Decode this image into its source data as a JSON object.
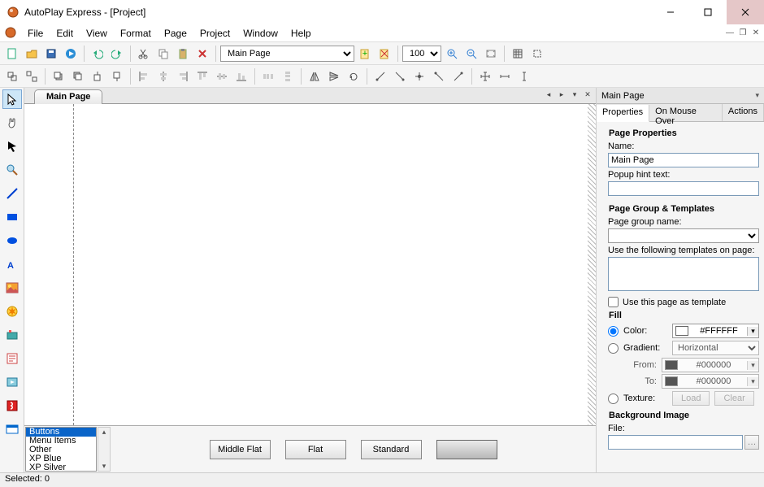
{
  "window": {
    "title": "AutoPlay Express - [Project]"
  },
  "menu": {
    "items": [
      "File",
      "Edit",
      "View",
      "Format",
      "Page",
      "Project",
      "Window",
      "Help"
    ]
  },
  "toolbar1": {
    "page_combo": "Main Page",
    "zoom_combo": "100%"
  },
  "page_tab": {
    "label": "Main Page"
  },
  "tool_palette": {
    "categories": [
      "Buttons",
      "Menu Items",
      "Other",
      "XP Blue",
      "XP Silver"
    ],
    "previews": [
      "Middle Flat",
      "Flat",
      "Standard",
      ""
    ]
  },
  "props": {
    "header": "Main Page",
    "tabs": [
      "Properties",
      "On Mouse Over",
      "Actions"
    ],
    "page_properties": {
      "title": "Page Properties",
      "name_label": "Name:",
      "name_value": "Main Page",
      "hint_label": "Popup hint text:",
      "hint_value": ""
    },
    "group_templates": {
      "title": "Page Group & Templates",
      "group_label": "Page group name:",
      "group_value": "",
      "use_templates_label": "Use the following templates on page:",
      "use_as_template_label": "Use this page as template"
    },
    "fill": {
      "title": "Fill",
      "color_label": "Color:",
      "color_value": "#FFFFFF",
      "gradient_label": "Gradient:",
      "gradient_value": "Horizontal",
      "from_label": "From:",
      "from_value": "#000000",
      "to_label": "To:",
      "to_value": "#000000",
      "texture_label": "Texture:",
      "load_btn": "Load",
      "clear_btn": "Clear"
    },
    "bg": {
      "title": "Background Image",
      "file_label": "File:",
      "file_value": ""
    }
  },
  "status": {
    "selected": "Selected: 0"
  }
}
